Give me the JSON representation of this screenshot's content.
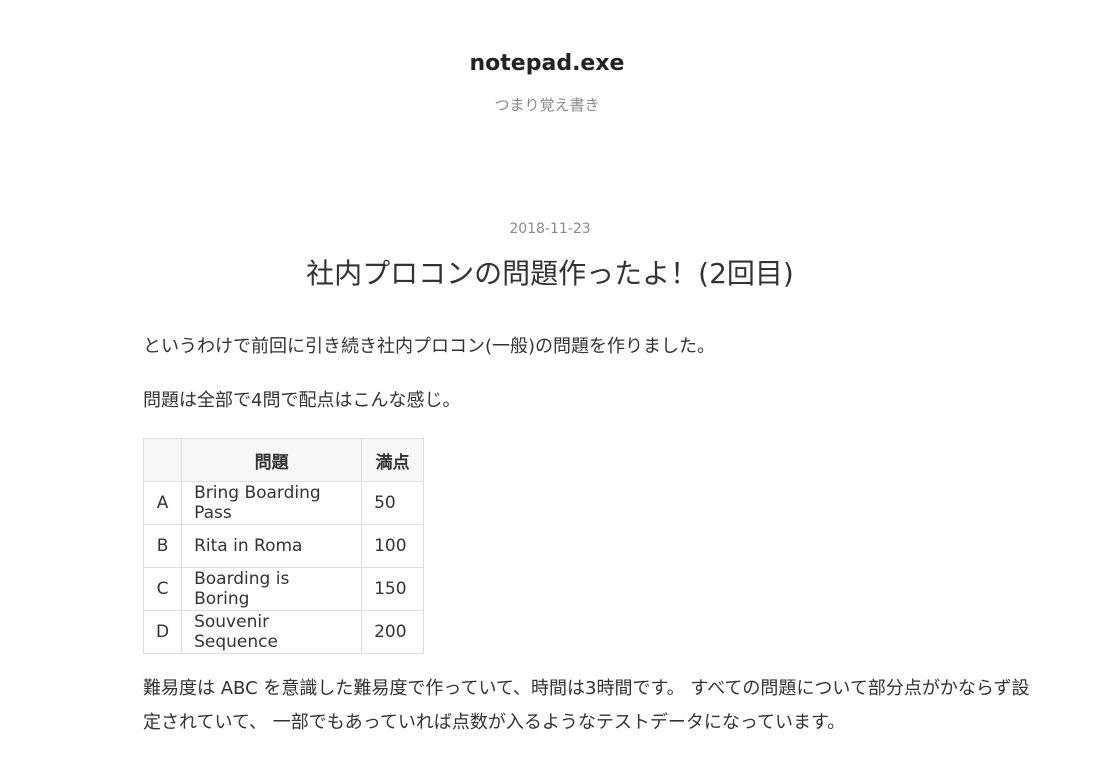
{
  "site": {
    "title": "notepad.exe",
    "tagline": "つまり覚え書き"
  },
  "post": {
    "date": "2018-11-23",
    "title": "社内プロコンの問題作ったよ！(2回目)",
    "paragraphs": [
      "というわけで前回に引き続き社内プロコン(一般)の問題を作りました。",
      "問題は全部で4問で配点はこんな感じ。",
      "難易度は ABC を意識した難易度で作っていて、時間は3時間です。 すべての問題について部分点がかならず設定されていて、 一部でもあっていれば点数が入るようなテストデータになっています。"
    ],
    "table": {
      "headers": [
        "",
        "問題",
        "満点"
      ],
      "rows": [
        {
          "id": "A",
          "name": "Bring Boarding Pass",
          "score": "50"
        },
        {
          "id": "B",
          "name": "Rita in Roma",
          "score": "100"
        },
        {
          "id": "C",
          "name": "Boarding is Boring",
          "score": "150"
        },
        {
          "id": "D",
          "name": "Souvenir Sequence",
          "score": "200"
        }
      ]
    }
  }
}
